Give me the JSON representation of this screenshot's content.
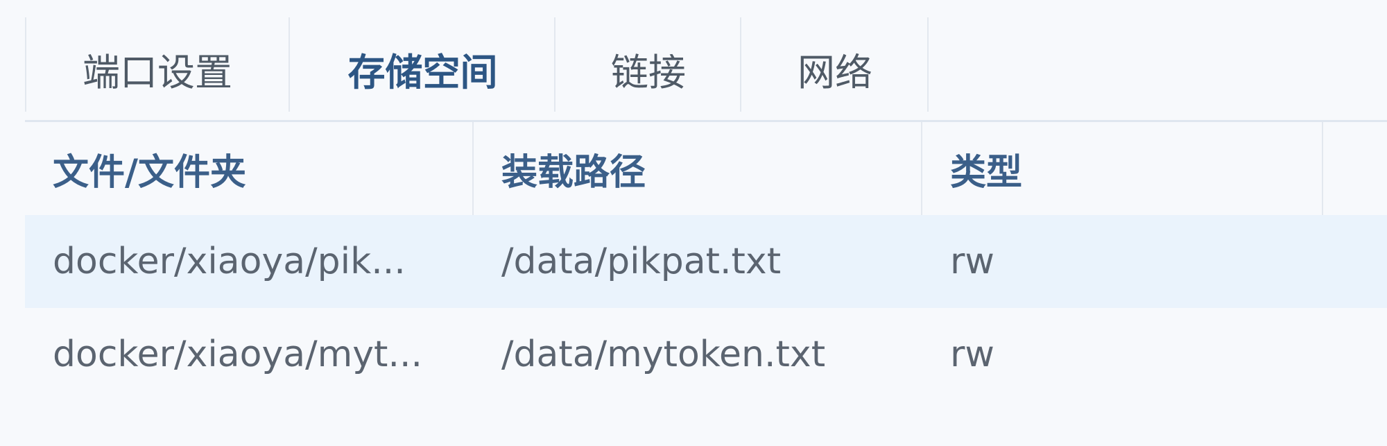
{
  "tabs": [
    {
      "label": "端口设置",
      "active": false
    },
    {
      "label": "存储空间",
      "active": true
    },
    {
      "label": "链接",
      "active": false
    },
    {
      "label": "网络",
      "active": false
    }
  ],
  "table": {
    "columns": [
      "文件/文件夹",
      "装载路径",
      "类型"
    ],
    "rows": [
      {
        "file": "docker/xiaoya/pik...",
        "path": "/data/pikpat.txt",
        "type": "rw",
        "selected": true
      },
      {
        "file": "docker/xiaoya/myt...",
        "path": "/data/mytoken.txt",
        "type": "rw",
        "selected": false
      }
    ]
  },
  "colors": {
    "active_tab": "#2d5684",
    "header_text": "#3b5f89",
    "selected_row": "#eaf3fc"
  }
}
